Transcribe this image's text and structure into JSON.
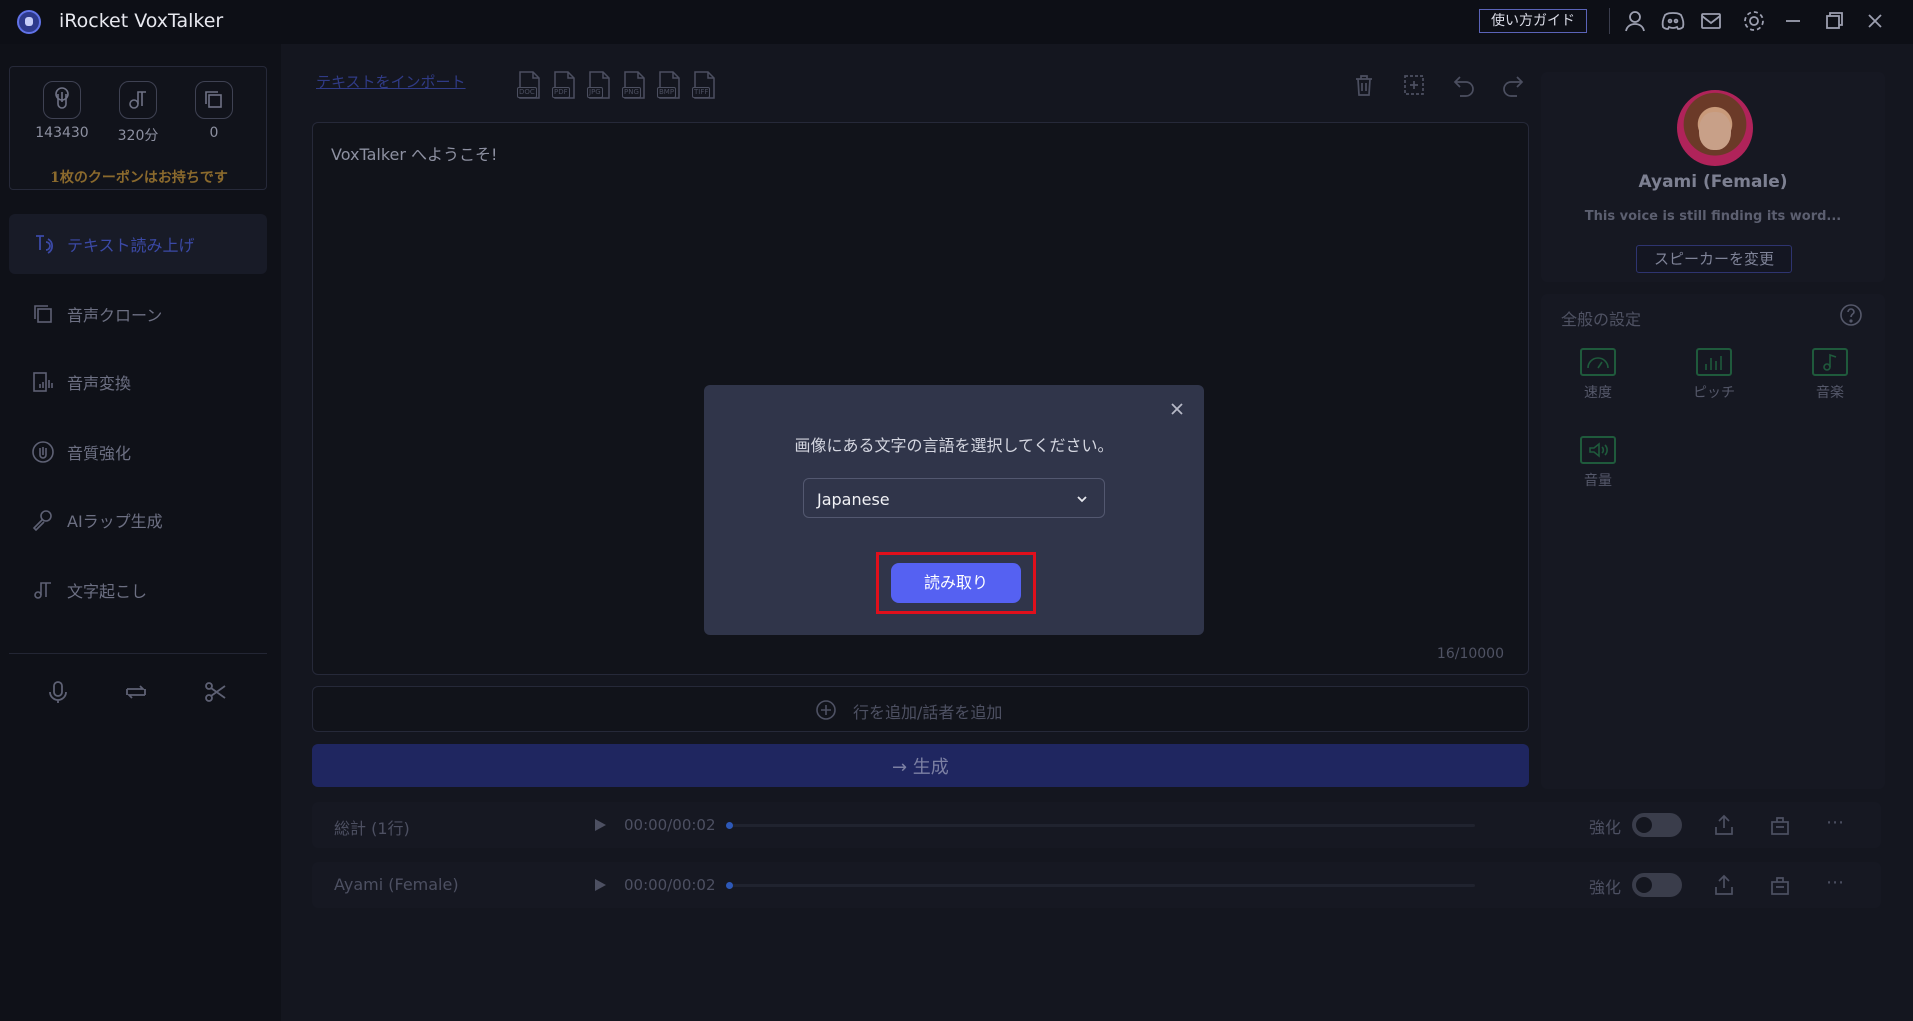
{
  "app": {
    "title": "iRocket VoxTalker",
    "guide_label": "使い方ガイド"
  },
  "sidebar": {
    "stats": [
      {
        "icon": "voice-credit-icon",
        "value": "143430"
      },
      {
        "icon": "minutes-icon",
        "value": "320分"
      },
      {
        "icon": "clone-count-icon",
        "value": "0"
      }
    ],
    "coupon_text": "1枚のクーポンはお持ちです",
    "nav": [
      {
        "label": "テキスト読み上げ",
        "icon": "text-to-speech-icon",
        "active": true
      },
      {
        "label": "音声クローン",
        "icon": "voice-clone-icon"
      },
      {
        "label": "音声変換",
        "icon": "voice-change-icon"
      },
      {
        "label": "音質強化",
        "icon": "audio-enhance-icon"
      },
      {
        "label": "AIラップ生成",
        "icon": "ai-rap-icon"
      },
      {
        "label": "文字起こし",
        "icon": "transcribe-icon"
      }
    ],
    "tools": [
      "microphone-icon",
      "convert-icon",
      "scissors-icon"
    ]
  },
  "toolbar": {
    "import_label": "テキストをインポート",
    "file_types": [
      "DOC",
      "PDF",
      "JPG",
      "PNG",
      "BMP",
      "TIFF"
    ]
  },
  "editor": {
    "text": "VoxTalker へようこそ!",
    "char_count": "16/10000",
    "add_row_label": "行を追加/話者を追加",
    "generate_label": "→ 生成"
  },
  "audio_rows": [
    {
      "name": "総計 (1行)",
      "time": "00:00/00:02",
      "progress": 0,
      "enhance_label": "強化",
      "enhance_on": false
    },
    {
      "name": "Ayami (Female)",
      "time": "00:00/00:02",
      "progress": 0,
      "enhance_label": "強化",
      "enhance_on": false
    }
  ],
  "speaker": {
    "name": "Ayami (Female)",
    "description": "This voice is still finding its word...",
    "change_label": "スピーカーを変更"
  },
  "settings": {
    "title": "全般の設定",
    "items": [
      {
        "label": "速度",
        "icon": "speed-icon"
      },
      {
        "label": "ピッチ",
        "icon": "pitch-icon"
      },
      {
        "label": "音楽",
        "icon": "music-icon"
      },
      {
        "label": "音量",
        "icon": "volume-icon"
      }
    ]
  },
  "modal": {
    "prompt": "画像にある文字の言語を選択してください。",
    "selected_language": "Japanese",
    "read_label": "読み取り"
  },
  "colors": {
    "accent": "#5561f2",
    "highlight": "#e00f1c",
    "setting_icon": "#1f5a3c"
  }
}
